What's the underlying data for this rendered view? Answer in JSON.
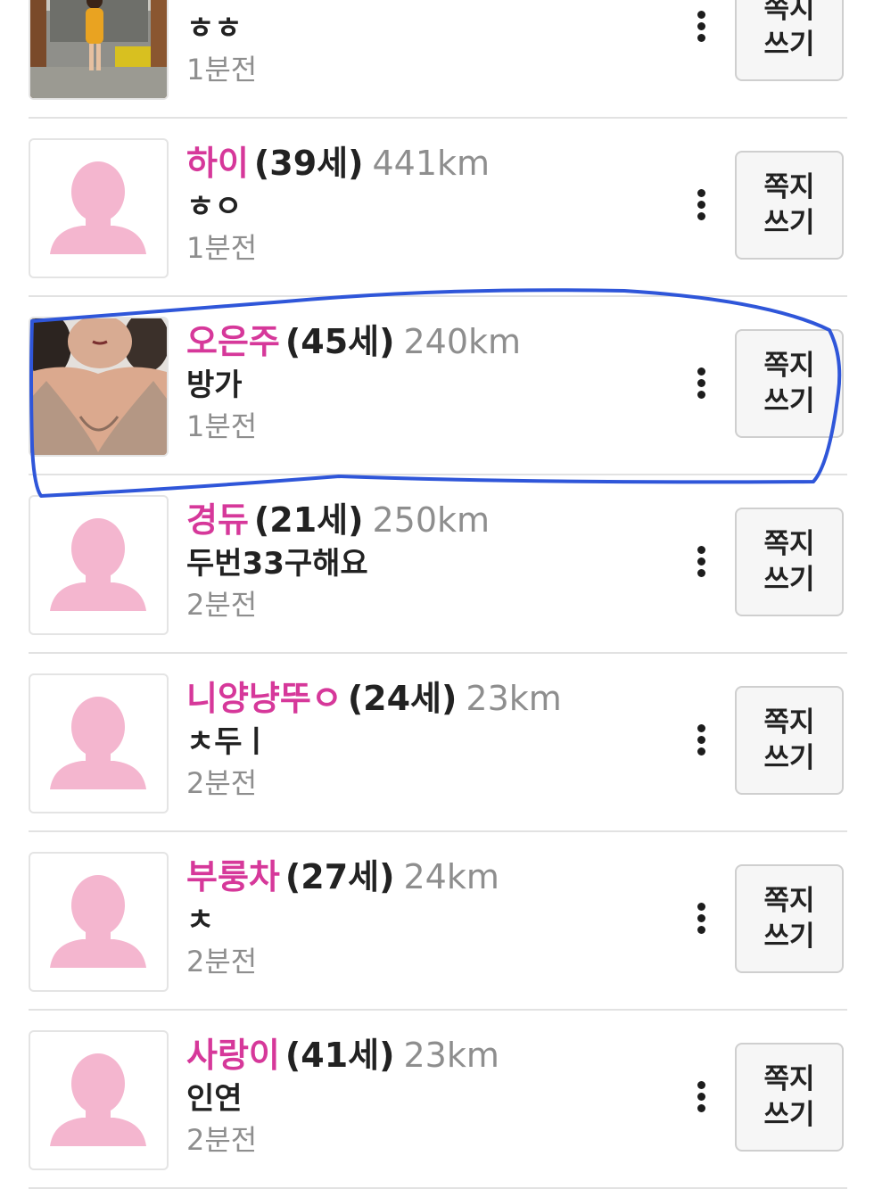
{
  "button_label_line1": "쪽지",
  "button_label_line2": "쓰기",
  "accent_colors": {
    "nickname": "#d6389a",
    "placeholder_avatar": "#f4b6cf",
    "highlight_stroke": "#2f56d9"
  },
  "users": [
    {
      "nickname": "",
      "age": "",
      "distance": "",
      "message": "ㅎㅎ",
      "time": "1분전",
      "avatar": "photo-woman-yellow-coat"
    },
    {
      "nickname": "하이",
      "age": "(39세)",
      "distance": "441km",
      "message": "ㅎㅇ",
      "time": "1분전",
      "avatar": "default-silhouette-icon"
    },
    {
      "nickname": "오은주",
      "age": "(45세)",
      "distance": "240km",
      "message": "방가",
      "time": "1분전",
      "avatar": "photo-woman"
    },
    {
      "nickname": "경듀",
      "age": "(21세)",
      "distance": "250km",
      "message": "두번33구해요",
      "time": "2분전",
      "avatar": "default-silhouette-icon"
    },
    {
      "nickname": "니양냥뚜ㅇ",
      "age": "(24세)",
      "distance": "23km",
      "message": "ㅊ두ㅣ",
      "time": "2분전",
      "avatar": "default-silhouette-icon"
    },
    {
      "nickname": "부룽차",
      "age": "(27세)",
      "distance": "24km",
      "message": "ㅊ",
      "time": "2분전",
      "avatar": "default-silhouette-icon"
    },
    {
      "nickname": "사랑이",
      "age": "(41세)",
      "distance": "23km",
      "message": "인연",
      "time": "2분전",
      "avatar": "default-silhouette-icon"
    }
  ]
}
